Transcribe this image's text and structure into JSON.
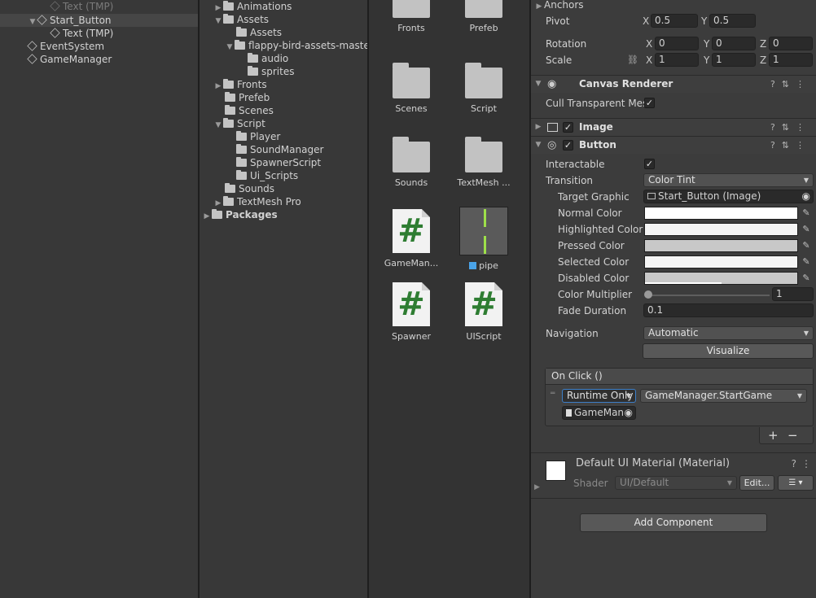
{
  "hierarchy": {
    "items": [
      {
        "label": "Text (TMP)"
      },
      {
        "label": "Start_Button"
      },
      {
        "label": "Text (TMP)"
      },
      {
        "label": "EventSystem"
      },
      {
        "label": "GameManager"
      }
    ]
  },
  "folders": {
    "items": [
      {
        "label": "Animations"
      },
      {
        "label": "Assets"
      },
      {
        "label": "Assets"
      },
      {
        "label": "flappy-bird-assets-maste"
      },
      {
        "label": "audio"
      },
      {
        "label": "sprites"
      },
      {
        "label": "Fronts"
      },
      {
        "label": "Prefeb"
      },
      {
        "label": "Scenes"
      },
      {
        "label": "Script"
      },
      {
        "label": "Player"
      },
      {
        "label": "SoundManager"
      },
      {
        "label": "SpawnerScript"
      },
      {
        "label": "Ui_Scripts"
      },
      {
        "label": "Sounds"
      },
      {
        "label": "TextMesh Pro"
      },
      {
        "label": "Packages"
      }
    ]
  },
  "assets": {
    "items": [
      {
        "label": "Fronts"
      },
      {
        "label": "Prefeb"
      },
      {
        "label": "Scenes"
      },
      {
        "label": "Script"
      },
      {
        "label": "Sounds"
      },
      {
        "label": "TextMesh ..."
      },
      {
        "label": "GameMan...",
        "glyph": "#"
      },
      {
        "label": "pipe"
      },
      {
        "label": "Spawner",
        "glyph": "#"
      },
      {
        "label": "UIScript",
        "glyph": "#"
      }
    ]
  },
  "inspector": {
    "transform": {
      "anchors_label": "Anchors",
      "pivot_label": "Pivot",
      "pivot_x": "0.5",
      "pivot_y": "0.5",
      "rotation_label": "Rotation",
      "rot_x": "0",
      "rot_y": "0",
      "rot_z": "0",
      "scale_label": "Scale",
      "scale_x": "1",
      "scale_y": "1",
      "scale_z": "1",
      "axis_x": "X",
      "axis_y": "Y",
      "axis_z": "Z"
    },
    "canvas_renderer": {
      "title": "Canvas Renderer",
      "cull_label": "Cull Transparent Mes",
      "cull_checked": "✓"
    },
    "image": {
      "title": "Image",
      "enabled": "✓"
    },
    "button": {
      "title": "Button",
      "enabled": "✓",
      "interactable_label": "Interactable",
      "interactable_checked": "✓",
      "transition_label": "Transition",
      "transition_value": "Color Tint",
      "target_graphic_label": "Target Graphic",
      "target_graphic_value": "Start_Button (Image)",
      "normal_label": "Normal Color",
      "highlighted_label": "Highlighted Color",
      "pressed_label": "Pressed Color",
      "selected_label": "Selected Color",
      "disabled_label": "Disabled Color",
      "multiplier_label": "Color Multiplier",
      "multiplier_value": "1",
      "fade_label": "Fade Duration",
      "fade_value": "0.1",
      "navigation_label": "Navigation",
      "navigation_value": "Automatic",
      "visualize_label": "Visualize",
      "colors": {
        "normal": "#ffffff",
        "highlighted": "#f5f5f5",
        "pressed": "#c8c8c8",
        "selected": "#f5f5f5",
        "disabled": "#c8c8c8"
      }
    },
    "onclick": {
      "title": "On Click ()",
      "runtime_value": "Runtime Only",
      "function_value": "GameManager.StartGame",
      "object_value": "GameMan",
      "add": "+",
      "remove": "−"
    },
    "material": {
      "title": "Default UI Material (Material)",
      "shader_label": "Shader",
      "shader_value": "UI/Default",
      "edit_label": "Edit..."
    },
    "add_component_label": "Add Component"
  }
}
